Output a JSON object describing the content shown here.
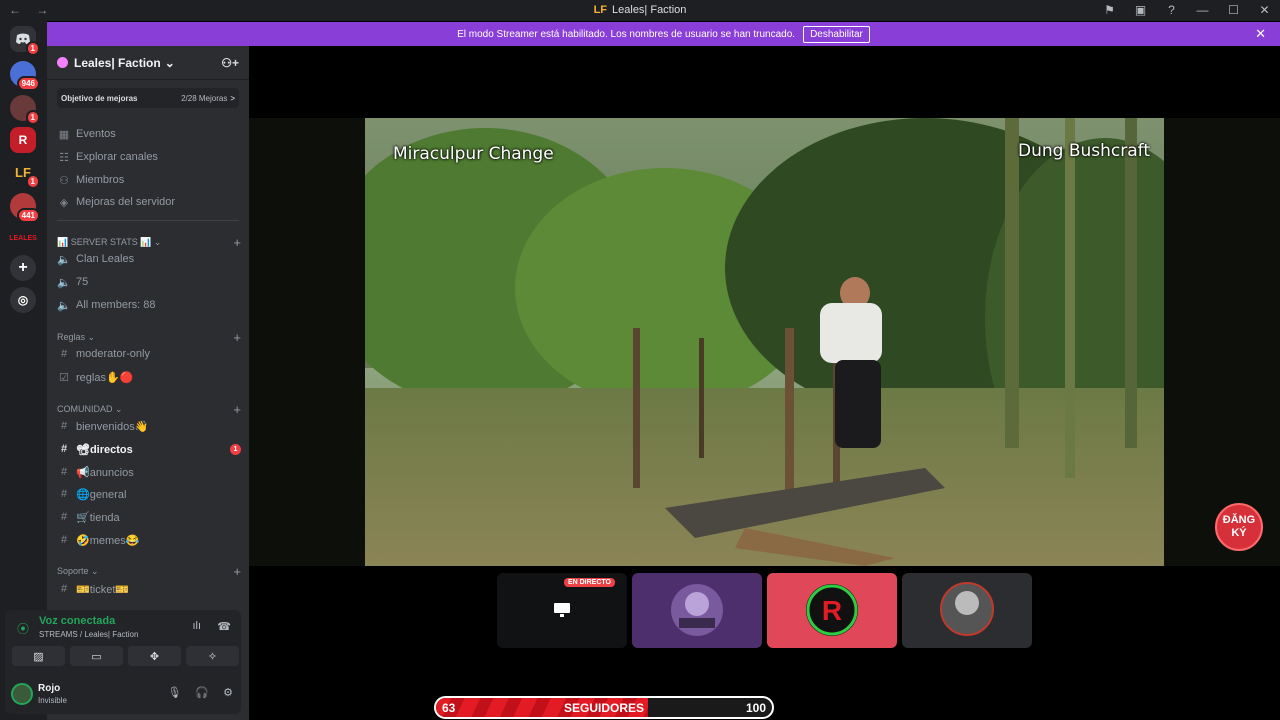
{
  "titlebar": {
    "logo": "LF",
    "title": "Leales| Faction",
    "nav": "← →",
    "icons": [
      "⚑",
      "▣",
      "?",
      "—",
      "☐",
      "✕"
    ]
  },
  "banner": {
    "text": "El modo Streamer está habilitado. Los nombres de usuario se han truncado.",
    "button": "Deshabilitar",
    "close": "✕"
  },
  "rail": {
    "badges": [
      "1",
      "946",
      "1",
      "1",
      "441"
    ],
    "labels": [
      "R",
      "LF",
      "LEALES"
    ]
  },
  "server": {
    "name": "Leales| Faction",
    "chevron": "⌄"
  },
  "boost": {
    "label": "Objetivo de mejoras",
    "count": "2/28 Mejoras",
    "arrow": ">"
  },
  "menu": [
    {
      "label": "Eventos",
      "icon": "▦"
    },
    {
      "label": "Explorar canales",
      "icon": "☷"
    },
    {
      "label": "Miembros",
      "icon": "⚇"
    },
    {
      "label": "Mejoras del servidor",
      "icon": "◈"
    }
  ],
  "categories": {
    "stats": "📊 SERVER STATS 📊 ⌄",
    "reglas": "Reglas ⌄",
    "comunidad": "COMUNIDAD ⌄",
    "soporte": "Soporte ⌄"
  },
  "stats_channels": [
    "Clan Leales",
    "75",
    "All members: 88"
  ],
  "reglas_channels": [
    "moderator-only",
    "reglas✋🔴"
  ],
  "comunidad_channels": [
    "bienvenidos👋",
    "📽directos",
    "📢anuncios",
    "🌐general",
    "🛒tienda",
    "🤣memes😂"
  ],
  "directos_badge": "1",
  "soporte_channels": [
    "🎫ticket🎫"
  ],
  "voice": {
    "status": "Voz conectada",
    "channel": "STREAMS / Leales| Faction"
  },
  "user": {
    "name": "Rojo",
    "status": "Invisible"
  },
  "video": {
    "overlay_left": "Miraculpur Change",
    "overlay_right": "Dung Bushcraft",
    "subscribe": "ĐĂNG KÝ"
  },
  "tiles": {
    "live_label": "EN DIRECTO"
  },
  "followers": {
    "current": "63",
    "label": "SEGUIDORES",
    "goal": "100",
    "progress": 0.63
  },
  "colors": {
    "banner": "#8a3ed8",
    "accent_red": "#e21b24",
    "voice_green": "#23a55a",
    "tile_pink": "#e0485a",
    "tile_purple": "#4e2f6e"
  }
}
